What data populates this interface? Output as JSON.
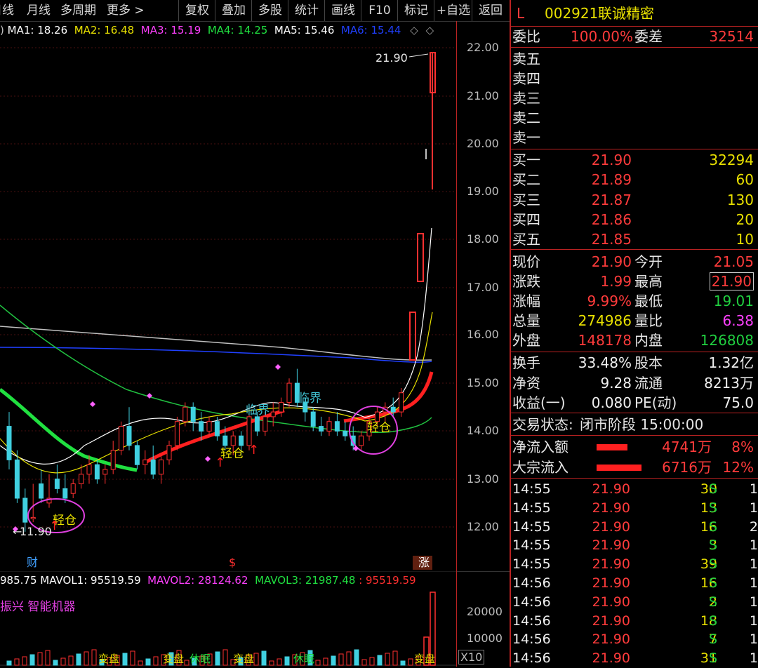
{
  "toolbar": {
    "items": [
      "日线",
      "月线",
      "多周期",
      "更多 >",
      "复权",
      "叠加",
      "多股",
      "统计",
      "画线",
      "F10",
      "标记",
      "+自选",
      "返回"
    ]
  },
  "ma_legend": [
    {
      "label": "MA1: 18.26",
      "color": "#ffffff"
    },
    {
      "label": "MA2: 16.48",
      "color": "#e8e000"
    },
    {
      "label": "MA3: 15.19",
      "color": "#ff40ff"
    },
    {
      "label": "MA4: 14.25",
      "color": "#20e040"
    },
    {
      "label": "MA5: 15.46",
      "color": "#ffffff"
    },
    {
      "label": "MA6: 15.44",
      "color": "#2040ff"
    }
  ],
  "chart": {
    "price_ticks": [
      "22.00",
      "21.00",
      "20.00",
      "19.00",
      "18.00",
      "17.00",
      "16.00",
      "15.00",
      "14.00",
      "13.00",
      "12.00"
    ],
    "high_label": "21.90",
    "low_label": "11.90",
    "annotations": [
      "轻仓",
      "轻仓",
      "轻仓",
      "临界",
      "临界"
    ],
    "bottom_markers": [
      "财",
      "$",
      "涨"
    ],
    "colors": {
      "up": "#ff3030",
      "down": "#40d0e0",
      "ma_thick_red": "#ff2020",
      "ma_thick_green": "#20e040"
    }
  },
  "volume": {
    "legend": [
      {
        "label": "985.75",
        "color": "#ffffff"
      },
      {
        "label": "MAVOL1: 95519.59",
        "color": "#ffffff"
      },
      {
        "label": "MAVOL2: 28124.62",
        "color": "#ff40ff"
      },
      {
        "label": "MAVOL3: 21987.48",
        "color": "#20e040"
      },
      {
        "label": ": 95519.59",
        "color": "#ff3030"
      }
    ],
    "ticks": [
      "20000",
      "10000",
      "X10"
    ],
    "concept": "振兴 智能机器",
    "bottom_labels": [
      "变盘",
      "变盘",
      "休眠",
      "变盘",
      "休眠",
      "变盘"
    ]
  },
  "quote": {
    "header": {
      "flag": "L",
      "code": "002921",
      "name": "联诚精密"
    },
    "weibi": {
      "label": "委比",
      "value": "100.00%"
    },
    "weicha": {
      "label": "委差",
      "value": "32514"
    },
    "sell": [
      {
        "label": "卖五"
      },
      {
        "label": "卖四"
      },
      {
        "label": "卖三"
      },
      {
        "label": "卖二"
      },
      {
        "label": "卖一"
      }
    ],
    "buy": [
      {
        "label": "买一",
        "price": "21.90",
        "vol": "32294"
      },
      {
        "label": "买二",
        "price": "21.89",
        "vol": "60"
      },
      {
        "label": "买三",
        "price": "21.87",
        "vol": "130"
      },
      {
        "label": "买四",
        "price": "21.86",
        "vol": "20"
      },
      {
        "label": "买五",
        "price": "21.85",
        "vol": "10"
      }
    ],
    "stats": [
      {
        "l1": "现价",
        "v1": "21.90",
        "l2": "今开",
        "v2": "21.05"
      },
      {
        "l1": "涨跌",
        "v1": "1.99",
        "l2": "最高",
        "v2": "21.90"
      },
      {
        "l1": "涨幅",
        "v1": "9.99%",
        "l2": "最低",
        "v2": "19.01"
      },
      {
        "l1": "总量",
        "v1": "274986",
        "l2": "量比",
        "v2": "6.38"
      },
      {
        "l1": "外盘",
        "v1": "148178",
        "l2": "内盘",
        "v2": "126808"
      }
    ],
    "fin": [
      {
        "l1": "换手",
        "v1": "33.48%",
        "l2": "股本",
        "v2": "1.32亿"
      },
      {
        "l1": "净资",
        "v1": "9.28",
        "l2": "流通",
        "v2": "8213万"
      },
      {
        "l1": "收益(一)",
        "v1": "0.080",
        "l2": "PE(动)",
        "v2": "75.0"
      }
    ],
    "status": {
      "label": "交易状态:",
      "value": "闭市阶段 15:00:00"
    },
    "flows": [
      {
        "label": "净流入额",
        "amount": "4741万",
        "pct": "8%",
        "bar": 0.55
      },
      {
        "label": "大宗流入",
        "amount": "6716万",
        "pct": "12%",
        "bar": 0.8
      }
    ],
    "trades": [
      {
        "time": "14:55",
        "price": "21.90",
        "vol": "30",
        "bs": "S",
        "n": "1"
      },
      {
        "time": "14:55",
        "price": "21.90",
        "vol": "13",
        "bs": "S",
        "n": "1"
      },
      {
        "time": "14:55",
        "price": "21.90",
        "vol": "16",
        "bs": "S",
        "n": "2"
      },
      {
        "time": "14:55",
        "price": "21.90",
        "vol": "3",
        "bs": "S",
        "n": "1"
      },
      {
        "time": "14:55",
        "price": "21.90",
        "vol": "39",
        "bs": "S",
        "n": "1"
      },
      {
        "time": "14:56",
        "price": "21.90",
        "vol": "16",
        "bs": "S",
        "n": "1"
      },
      {
        "time": "14:56",
        "price": "21.90",
        "vol": "2",
        "bs": "S",
        "n": "1"
      },
      {
        "time": "14:56",
        "price": "21.90",
        "vol": "18",
        "bs": "S",
        "n": "1"
      },
      {
        "time": "14:56",
        "price": "21.90",
        "vol": "7",
        "bs": "S",
        "n": "1"
      },
      {
        "time": "14:56",
        "price": "21.90",
        "vol": "31",
        "bs": "S",
        "n": "1"
      }
    ]
  }
}
